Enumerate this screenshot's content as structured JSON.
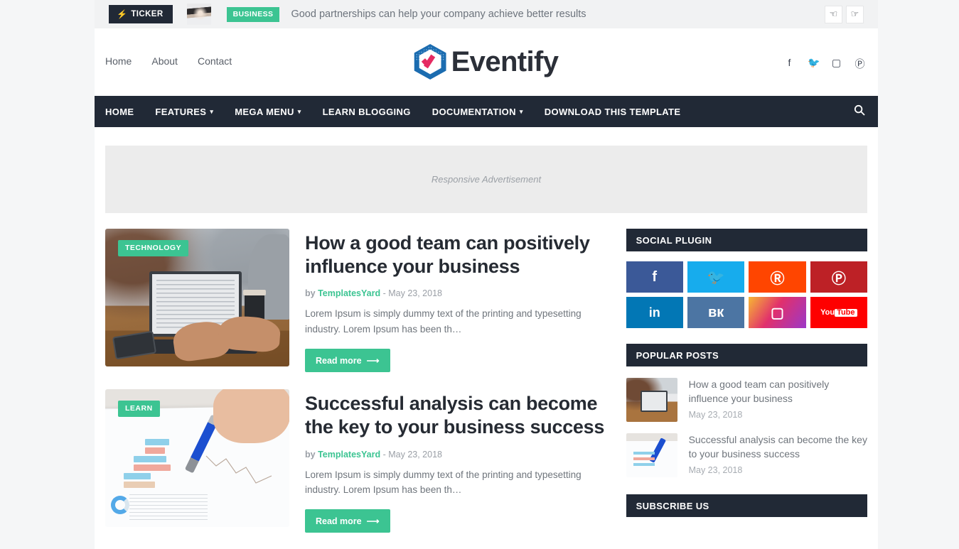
{
  "ticker": {
    "tag_label": "TICKER",
    "bolt_icon": "bolt-icon",
    "category": "BUSINESS",
    "headline": "Good partnerships can help your company achieve better results",
    "prev_icon": "☜",
    "next_icon": "☞"
  },
  "header": {
    "top_links": [
      {
        "label": "Home"
      },
      {
        "label": "About"
      },
      {
        "label": "Contact"
      }
    ],
    "logo_text": "Eventify",
    "social": [
      {
        "name": "facebook-icon",
        "glyph": "f"
      },
      {
        "name": "twitter-icon",
        "glyph": "ᴠ"
      },
      {
        "name": "instagram-icon",
        "glyph": "□"
      },
      {
        "name": "pinterest-icon",
        "glyph": "Ⓟ"
      }
    ]
  },
  "nav": {
    "items": [
      {
        "label": "HOME",
        "caret": ""
      },
      {
        "label": "FEATURES",
        "caret": "▾"
      },
      {
        "label": "MEGA MENU",
        "caret": "▾"
      },
      {
        "label": "LEARN BLOGGING",
        "caret": ""
      },
      {
        "label": "DOCUMENTATION",
        "caret": "▾"
      },
      {
        "label": "DOWNLOAD THIS TEMPLATE",
        "caret": ""
      }
    ],
    "search_icon": "⌕"
  },
  "ad": {
    "label": "Responsive Advertisement"
  },
  "posts": [
    {
      "badge": "TECHNOLOGY",
      "title": "How a good team can positively influence your business",
      "by": "by",
      "author": "TemplatesYard",
      "date_sep": "-",
      "date": "May 23, 2018",
      "snippet": "Lorem Ipsum is simply dummy text of the printing and typesetting industry. Lorem Ipsum has been th…",
      "read_more": "Read more",
      "read_more_arrow": "⟶",
      "image_name": "office-team-laptop-photo"
    },
    {
      "badge": "LEARN",
      "title": "Successful analysis can become the key to your business success",
      "by": "by",
      "author": "TemplatesYard",
      "date_sep": "-",
      "date": "May 23, 2018",
      "snippet": "Lorem Ipsum is simply dummy text of the printing and typesetting industry. Lorem Ipsum has been th…",
      "read_more": "Read more",
      "read_more_arrow": "⟶",
      "image_name": "hand-pen-chart-report-photo"
    }
  ],
  "sidebar": {
    "social_plugin": {
      "title": "SOCIAL PLUGIN",
      "cells": [
        {
          "name": "facebook-button",
          "glyph": "f",
          "color": "#3b5998"
        },
        {
          "name": "twitter-button",
          "glyph": "ᴠ",
          "color": "#17aced"
        },
        {
          "name": "reddit-button",
          "glyph": "Ⓡ",
          "color": "#ff4500"
        },
        {
          "name": "pinterest-button",
          "glyph": "Ⓟ",
          "color": "#bd2126"
        },
        {
          "name": "linkedin-button",
          "glyph": "in",
          "color": "#0277b5"
        },
        {
          "name": "vk-button",
          "glyph": "вк",
          "color": "#4c75a3"
        },
        {
          "name": "instagram-button",
          "glyph": "□",
          "color": "#c13584"
        },
        {
          "name": "youtube-button",
          "glyph": "You",
          "glyph2": "Tube",
          "color": "#fe0000"
        }
      ]
    },
    "popular_posts": {
      "title": "POPULAR POSTS",
      "items": [
        {
          "title": "How a good team can positively influence your business",
          "date": "May 23, 2018"
        },
        {
          "title": "Successful analysis can become the key to your business success",
          "date": "May 23, 2018"
        }
      ]
    },
    "subscribe": {
      "title": "SUBSCRIBE US"
    }
  },
  "colors": {
    "accent_green": "#3cc492",
    "dark_navy": "#212936",
    "page_bg": "#f5f6f7",
    "ticker_bg": "#f1f2f3",
    "ad_bg": "#ececec"
  }
}
